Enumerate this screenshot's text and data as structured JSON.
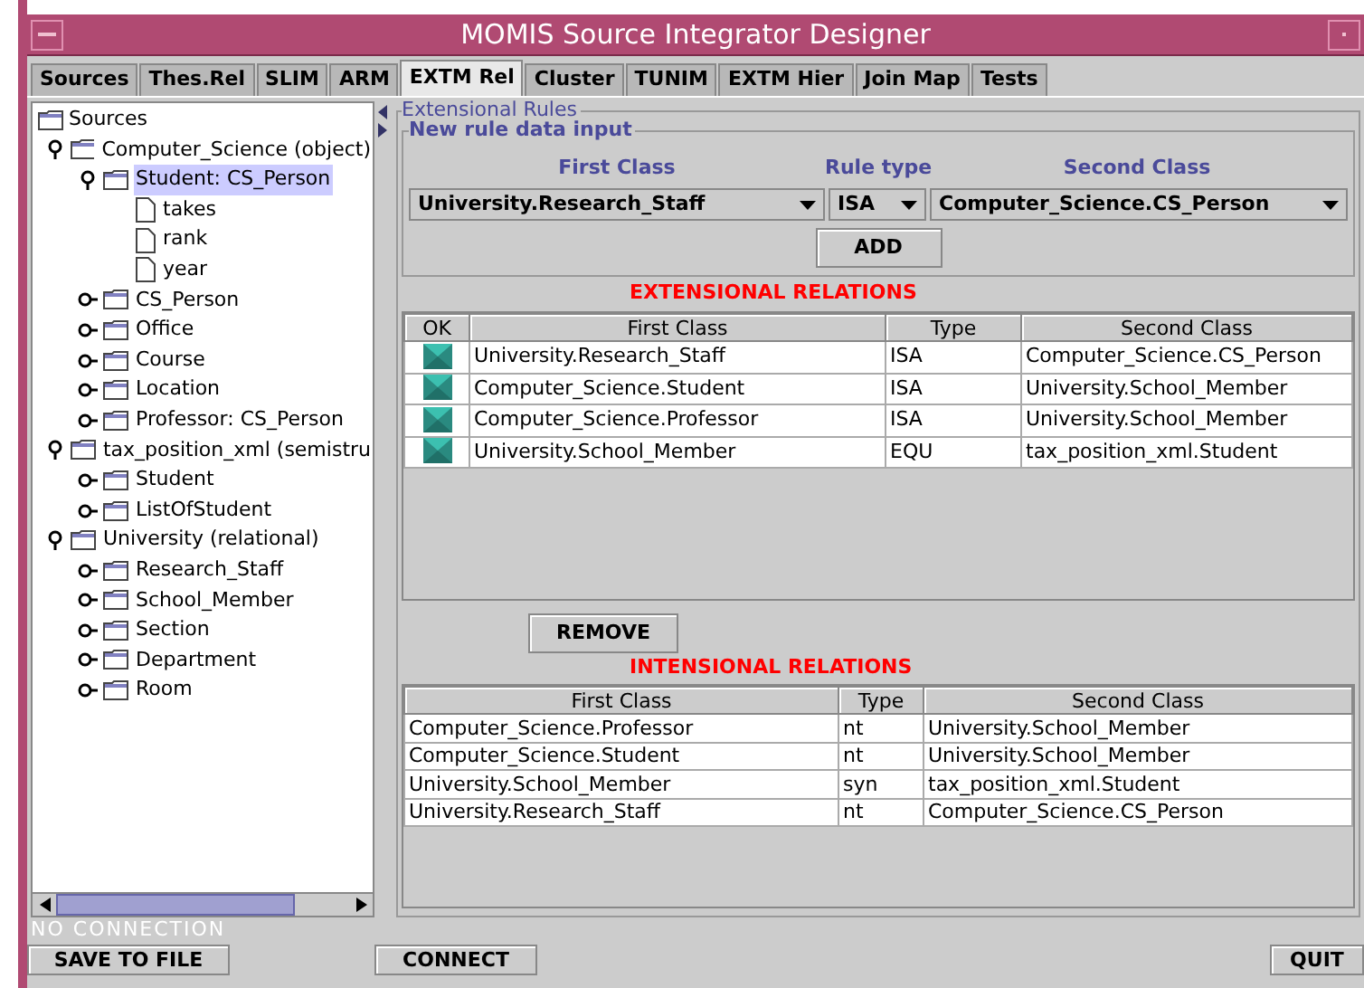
{
  "window": {
    "title": "MOMIS Source Integrator Designer"
  },
  "tabs": [
    {
      "label": "Sources",
      "selected": false
    },
    {
      "label": "Thes.Rel",
      "selected": false
    },
    {
      "label": "SLIM",
      "selected": false
    },
    {
      "label": "ARM",
      "selected": false
    },
    {
      "label": "EXTM Rel",
      "selected": true
    },
    {
      "label": "Cluster",
      "selected": false
    },
    {
      "label": "TUNIM",
      "selected": false
    },
    {
      "label": "EXTM Hier",
      "selected": false
    },
    {
      "label": "Join Map",
      "selected": false
    },
    {
      "label": "Tests",
      "selected": false
    }
  ],
  "tree": {
    "label": "Sources",
    "children": [
      {
        "label": "Computer_Science (object)",
        "kind": "folder",
        "expanded": true,
        "selected": false,
        "children": [
          {
            "label": "Student: CS_Person",
            "kind": "folder",
            "expanded": true,
            "selected": true,
            "children": [
              {
                "label": "takes",
                "kind": "leaf",
                "selected": false
              },
              {
                "label": "rank",
                "kind": "leaf",
                "selected": false
              },
              {
                "label": "year",
                "kind": "leaf",
                "selected": false
              }
            ]
          },
          {
            "label": "CS_Person",
            "kind": "folder",
            "expanded": false,
            "selected": false
          },
          {
            "label": "Office",
            "kind": "folder",
            "expanded": false,
            "selected": false
          },
          {
            "label": "Course",
            "kind": "folder",
            "expanded": false,
            "selected": false
          },
          {
            "label": "Location",
            "kind": "folder",
            "expanded": false,
            "selected": false
          },
          {
            "label": "Professor: CS_Person",
            "kind": "folder",
            "expanded": false,
            "selected": false
          }
        ]
      },
      {
        "label": "tax_position_xml (semistru",
        "kind": "folder",
        "expanded": true,
        "selected": false,
        "children": [
          {
            "label": "Student",
            "kind": "folder",
            "expanded": false,
            "selected": false
          },
          {
            "label": "ListOfStudent",
            "kind": "folder",
            "expanded": false,
            "selected": false
          }
        ]
      },
      {
        "label": "University (relational)",
        "kind": "folder",
        "expanded": true,
        "selected": false,
        "children": [
          {
            "label": "Research_Staff",
            "kind": "folder",
            "expanded": false,
            "selected": false
          },
          {
            "label": "School_Member",
            "kind": "folder",
            "expanded": false,
            "selected": false
          },
          {
            "label": "Section",
            "kind": "folder",
            "expanded": false,
            "selected": false
          },
          {
            "label": "Department",
            "kind": "folder",
            "expanded": false,
            "selected": false
          },
          {
            "label": "Room",
            "kind": "folder",
            "expanded": false,
            "selected": false
          }
        ]
      }
    ]
  },
  "extensional_rules": {
    "title": "Extensional Rules",
    "new_rule": {
      "title": "New rule data input",
      "first_class_label": "First Class",
      "rule_type_label": "Rule type",
      "second_class_label": "Second Class",
      "first_class": "University.Research_Staff",
      "rule_type": "ISA",
      "second_class": "Computer_Science.CS_Person",
      "add_button": "ADD"
    },
    "extensional_title": "EXTENSIONAL RELATIONS",
    "extensional_table": {
      "columns": [
        "OK",
        "First Class",
        "Type",
        "Second Class"
      ],
      "rows": [
        {
          "ok": true,
          "first": "University.Research_Staff",
          "type": "ISA",
          "second": "Computer_Science.CS_Person"
        },
        {
          "ok": true,
          "first": "Computer_Science.Student",
          "type": "ISA",
          "second": "University.School_Member"
        },
        {
          "ok": true,
          "first": "Computer_Science.Professor",
          "type": "ISA",
          "second": "University.School_Member"
        },
        {
          "ok": true,
          "first": "University.School_Member",
          "type": "EQU",
          "second": "tax_position_xml.Student"
        }
      ]
    },
    "remove_button": "REMOVE",
    "intensional_title": "INTENSIONAL RELATIONS",
    "intensional_table": {
      "columns": [
        "First Class",
        "Type",
        "Second Class"
      ],
      "rows": [
        {
          "first": "Computer_Science.Professor",
          "type": "nt",
          "second": "University.School_Member"
        },
        {
          "first": "Computer_Science.Student",
          "type": "nt",
          "second": "University.School_Member"
        },
        {
          "first": "University.School_Member",
          "type": "syn",
          "second": "tax_position_xml.Student"
        },
        {
          "first": "University.Research_Staff",
          "type": "nt",
          "second": "Computer_Science.CS_Person"
        }
      ]
    }
  },
  "status": "NO CONNECTION",
  "buttons": [
    "SAVE TO FILE",
    "CONNECT",
    "QUIT"
  ]
}
